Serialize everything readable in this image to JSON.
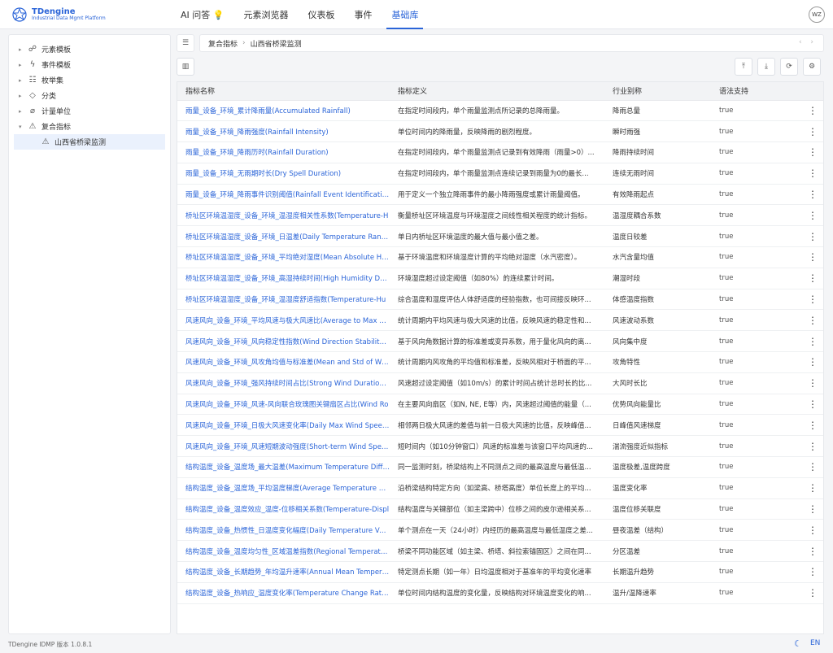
{
  "app": {
    "logo_title": "TDengine",
    "logo_sub": "Industrial Data Mgmt Platform",
    "avatar": "WZ"
  },
  "nav": [
    "AI 问答 💡",
    "元素浏览器",
    "仪表板",
    "事件",
    "基础库"
  ],
  "sidebar": [
    {
      "arrow": "▸",
      "icon": "☍",
      "label": "元素模板"
    },
    {
      "arrow": "▸",
      "icon": "ϟ",
      "label": "事件模板"
    },
    {
      "arrow": "▸",
      "icon": "☷",
      "label": "枚举集"
    },
    {
      "arrow": "▸",
      "icon": "◇",
      "label": "分类"
    },
    {
      "arrow": "▸",
      "icon": "⌀",
      "label": "计量单位"
    },
    {
      "arrow": "▾",
      "icon": "⚠",
      "label": "复合指标"
    }
  ],
  "sidebar_child": {
    "icon": "⚠",
    "label": "山西省桥梁监测"
  },
  "breadcrumb": {
    "root": "复合指标",
    "sep": "›",
    "leaf": "山西省桥梁监测",
    "arrows": "‹ ›"
  },
  "columns": [
    "指标名称",
    "指标定义",
    "行业别称",
    "语法支持"
  ],
  "rows": [
    [
      "雨量_设备_环境_累计降雨量(Accumulated Rainfall)",
      "在指定时间段内，单个雨量监测点所记录的总降雨量。",
      "降雨总量",
      "true"
    ],
    [
      "雨量_设备_环境_降雨强度(Rainfall Intensity)",
      "单位时间内的降雨量，反映降雨的剧烈程度。",
      "瞬时雨强",
      "true"
    ],
    [
      "雨量_设备_环境_降雨历时(Rainfall Duration)",
      "在指定时间段内，单个雨量监测点记录到有效降雨（雨量>0）...",
      "降雨持续时间",
      "true"
    ],
    [
      "雨量_设备_环境_无雨期时长(Dry Spell Duration)",
      "在指定时间段内，单个雨量监测点连续记录到雨量为0的最长...",
      "连续无雨时间",
      "true"
    ],
    [
      "雨量_设备_环境_降雨事件识别阈值(Rainfall Event Identification",
      "用于定义一个独立降雨事件的最小降雨强度或累计雨量阈值。",
      "有效降雨起点",
      "true"
    ],
    [
      "桥址区环境温湿度_设备_环境_温湿度相关性系数(Temperature-H",
      "衡量桥址区环境温度与环境湿度之间线性相关程度的统计指标。",
      "温湿度耦合系数",
      "true"
    ],
    [
      "桥址区环境温湿度_设备_环境_日温差(Daily Temperature Range)",
      "单日内桥址区环境温度的最大值与最小值之差。",
      "温度日较差",
      "true"
    ],
    [
      "桥址区环境温湿度_设备_环境_平均绝对湿度(Mean Absolute Hum",
      "基于环境温度和环境湿度计算的平均绝对湿度（水汽密度）。",
      "水汽含量均值",
      "true"
    ],
    [
      "桥址区环境温湿度_设备_环境_高湿持续时间(High Humidity Dura",
      "环境湿度超过设定阈值（如80%）的连续累计时间。",
      "潮湿时段",
      "true"
    ],
    [
      "桥址区环境温湿度_设备_环境_温湿度舒适指数(Temperature-Hu",
      "综合温度和湿度评估人体舒适度的经验指数，也可间接反映环...",
      "体感温度指数",
      "true"
    ],
    [
      "风速风向_设备_环境_平均风速与极大风速比(Average to Max Win",
      "统计周期内平均风速与极大风速的比值，反映风速的稳定性和...",
      "风速波动系数",
      "true"
    ],
    [
      "风速风向_设备_环境_风向稳定性指数(Wind Direction Stability In",
      "基于风向角数据计算的标准差或变异系数，用于量化风向的离...",
      "风向集中度",
      "true"
    ],
    [
      "风速风向_设备_环境_风攻角均值与标准差(Mean and Std of Wind",
      "统计周期内风攻角的平均值和标准差，反映风相对于桥面的平...",
      "攻角特性",
      "true"
    ],
    [
      "风速风向_设备_环境_强风持续时间占比(Strong Wind Duration Ra",
      "风速超过设定阈值（如10m/s）的累计时间占统计总时长的比...",
      "大风时长比",
      "true"
    ],
    [
      "风速风向_设备_环境_风速-风向联合玫瑰图关键扇区占比(Wind Ro",
      "在主要风向扇区（如N, NE, E等）内，风速超过阈值的能量（...",
      "优势风向能量比",
      "true"
    ],
    [
      "风速风向_设备_环境_日极大风速变化率(Daily Max Wind Speed C",
      "相邻两日极大风速的差值与前一日极大风速的比值，反映峰值...",
      "日峰值风速梯度",
      "true"
    ],
    [
      "风速风向_设备_环境_风速短期波动强度(Short-term Wind Speed",
      "短时间内（如10分钟窗口）风速的标准差与该窗口平均风速的...",
      "湍流强度近似指标",
      "true"
    ],
    [
      "结构温度_设备_温度场_最大温差(Maximum Temperature Differe",
      "同一监测时刻，桥梁结构上不同测点之间的最高温度与最低温...",
      "温度极差,温度跨度",
      "true"
    ],
    [
      "结构温度_设备_温度场_平均温度梯度(Average Temperature Grac",
      "沿桥梁结构特定方向（如梁高、桥塔高度）单位长度上的平均...",
      "温度变化率",
      "true"
    ],
    [
      "结构温度_设备_温度效应_温度-位移相关系数(Temperature-Displ",
      "结构温度与关键部位（如主梁跨中）位移之间的皮尔逊相关系...",
      "温度位移关联度",
      "true"
    ],
    [
      "结构温度_设备_热惯性_日温度变化幅度(Daily Temperature Varia",
      "单个测点在一天（24小时）内经历的最高温度与最低温度之差...",
      "昼夜温差（结构）",
      "true"
    ],
    [
      "结构温度_设备_温度均匀性_区域温差指数(Regional Temperature",
      "桥梁不同功能区域（如主梁、桥塔、斜拉索锚固区）之间在同...",
      "分区温差",
      "true"
    ],
    [
      "结构温度_设备_长期趋势_年均温升速率(Annual Mean Temperatu",
      "特定测点长期（如一年）日均温度相对于基准年的平均变化速率",
      "长期温升趋势",
      "true"
    ],
    [
      "结构温度_设备_热响应_温度变化率(Temperature Change Rate)...",
      "单位时间内结构温度的变化量，反映结构对环境温度变化的响...",
      "温升/温降速率",
      "true"
    ]
  ],
  "footer": {
    "version": "TDengine IDMP 版本 1.0.8.1",
    "lang": "EN"
  },
  "colors": {
    "accent": "#2a64d8"
  }
}
